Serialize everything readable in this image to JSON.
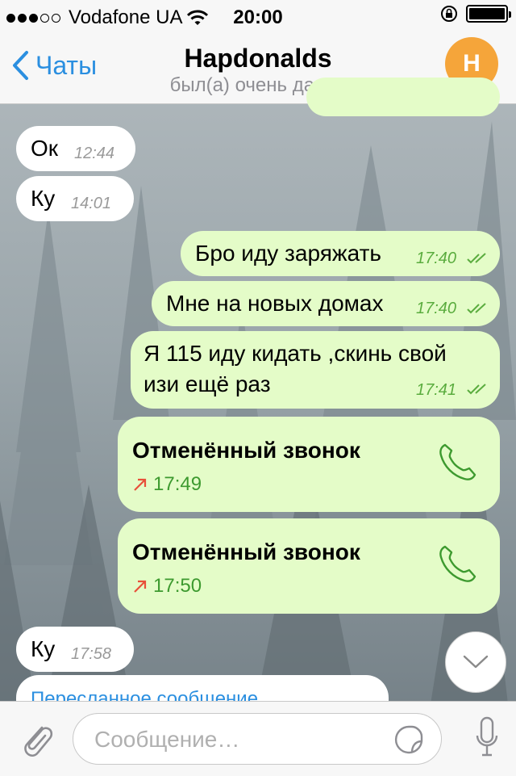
{
  "status_bar": {
    "carrier": "Vodafone UA",
    "time": "20:00"
  },
  "nav": {
    "back_label": "Чаты",
    "title": "Hapdonalds",
    "subtitle": "был(а) очень давно",
    "avatar_letter": "H",
    "avatar_color": "#f5a53a"
  },
  "messages": {
    "m1": {
      "text": "Ок",
      "time": "12:44"
    },
    "m2": {
      "text": "Ку",
      "time": "14:01"
    },
    "m3": {
      "text": "Бро иду заряжать",
      "time": "17:40"
    },
    "m4": {
      "text": "Мне на новых домах",
      "time": "17:40"
    },
    "m5": {
      "line1": "Я 115 иду кидать ,скинь свой",
      "line2": "изи ещё раз",
      "time": "17:41"
    },
    "m6": {
      "title": "Отменённый звонок",
      "time": "17:49"
    },
    "m7": {
      "title": "Отменённый звонок",
      "time": "17:50"
    },
    "m8": {
      "text": "Ку",
      "time": "17:58"
    },
    "m9": {
      "label": "Пересланное сообщение"
    }
  },
  "input": {
    "placeholder": "Сообщение…"
  },
  "colors": {
    "outgoing_bubble": "#e4fcc8",
    "incoming_bubble": "#ffffff",
    "accent": "#2b8fe0",
    "read_check": "#5aac3e",
    "call_arrow": "#e8503a"
  }
}
